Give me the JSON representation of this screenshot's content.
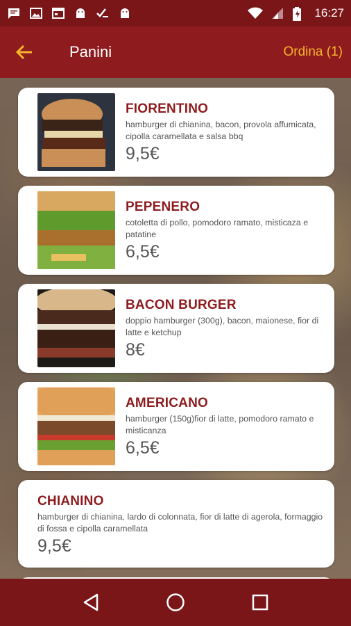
{
  "status_bar": {
    "time": "16:27",
    "left_icons": [
      "chat-icon",
      "image-icon",
      "calendar-icon",
      "android-icon",
      "checklist-icon",
      "android-icon"
    ],
    "right_icons": [
      "wifi-icon",
      "signal-icon",
      "battery-icon"
    ]
  },
  "app_bar": {
    "title": "Panini",
    "order_label": "Ordina (1)",
    "back_icon": "back-arrow-icon"
  },
  "colors": {
    "primary": "#8e1b1e",
    "status": "#7a1518",
    "accent": "#f6b52c",
    "item_name": "#8e1b1e"
  },
  "items": [
    {
      "name": "FIORENTINO",
      "description": "hamburger di chianina, bacon, provola affumicata, cipolla caramellata e salsa bbq",
      "price": "9,5€"
    },
    {
      "name": "PEPENERO",
      "description": "cotoletta di pollo, pomodoro ramato, misticaza e patatine",
      "price": "6,5€"
    },
    {
      "name": "BACON BURGER",
      "description": "doppio hamburger (300g), bacon, maionese, fior di latte e ketchup",
      "price": "8€"
    },
    {
      "name": "AMERICANO",
      "description": "hamburger (150g)fior di latte, pomodoro ramato e misticanza",
      "price": "6,5€"
    },
    {
      "name": "CHIANINO",
      "description": "hamburger di chianina, lardo di colonnata, fior di latte di agerola, formaggio di fossa e cipolla caramellata",
      "price": "9,5€"
    }
  ],
  "nav_bar": {
    "icons": [
      "back-triangle-icon",
      "home-circle-icon",
      "recents-square-icon"
    ]
  }
}
